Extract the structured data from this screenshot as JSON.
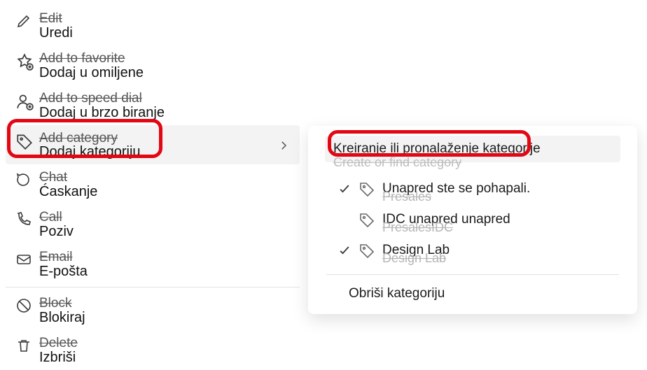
{
  "menu": {
    "edit": {
      "primary": "Edit",
      "overlay": "Uredi"
    },
    "favorite": {
      "primary": "Add to favorite",
      "overlay": "Dodaj u omiljene"
    },
    "speeddial": {
      "primary": "Add to speed dial",
      "overlay": "Dodaj u brzo biranje"
    },
    "addcategory": {
      "primary": "Add category",
      "overlay": "Dodaj kategoriju"
    },
    "chat": {
      "primary": "Chat",
      "overlay": "Ćaskanje"
    },
    "call": {
      "primary": "Call",
      "overlay": "Poziv"
    },
    "email": {
      "primary": "Email",
      "overlay": "E-pošta"
    },
    "block": {
      "primary": "Block",
      "overlay": "Blokiraj"
    },
    "delete": {
      "primary": "Delete",
      "overlay": "Izbriši"
    }
  },
  "categories": {
    "search_front": "Kreiranje ili pronalaženje kategorije",
    "search_ghost": "Create or find category",
    "items": [
      {
        "front": "Unapred ste se pohapali.",
        "ghost": "Presales",
        "checked": true
      },
      {
        "front": "IDC unapred unapred",
        "ghost": "PresalesIDC",
        "checked": false
      },
      {
        "front": "Design Lab",
        "ghost": "Design Lab",
        "checked": true
      }
    ],
    "clear": "Obriši kategoriju"
  }
}
